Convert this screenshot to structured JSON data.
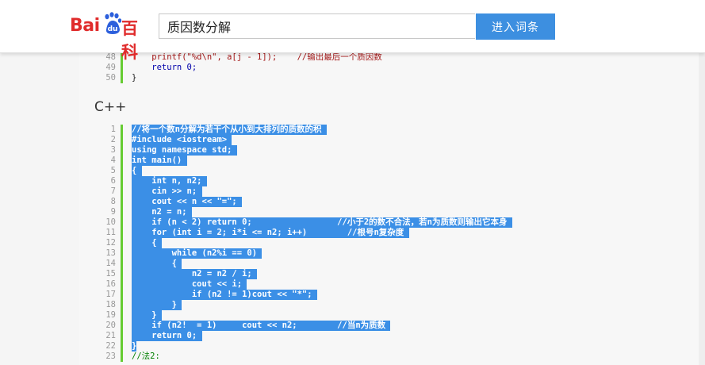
{
  "header": {
    "logo_text_left": "Bai",
    "logo_text_du": "du",
    "logo_text_baike": "百科",
    "search_value": "质因数分解",
    "search_button": "进入词条"
  },
  "top_code": [
    {
      "ln": "48",
      "text": "    printf(\"%d\\n\", a[j - 1]);    //输出最后一个质因数"
    },
    {
      "ln": "49",
      "text": "    return 0;"
    },
    {
      "ln": "50",
      "text": "}"
    }
  ],
  "section_heading": "C++",
  "cpp_code": [
    {
      "ln": "1",
      "text": "//将一个数n分解为若干个从小到大排列的质数的积 "
    },
    {
      "ln": "2",
      "text": "#include <iostream> "
    },
    {
      "ln": "3",
      "text": "using namespace std; "
    },
    {
      "ln": "4",
      "text": "int main() "
    },
    {
      "ln": "5",
      "text": "{ "
    },
    {
      "ln": "6",
      "text": "    int n, n2; "
    },
    {
      "ln": "7",
      "text": "    cin >> n; "
    },
    {
      "ln": "8",
      "text": "    cout << n << \"=\"; "
    },
    {
      "ln": "9",
      "text": "    n2 = n; "
    },
    {
      "ln": "10",
      "text": "    if (n < 2) return 0;                 //小于2的数不合法，若n为质数则输出它本身 "
    },
    {
      "ln": "11",
      "text": "    for (int i = 2; i*i <= n2; i++)        //根号n复杂度 "
    },
    {
      "ln": "12",
      "text": "    { "
    },
    {
      "ln": "13",
      "text": "        while (n2%i == 0) "
    },
    {
      "ln": "14",
      "text": "        { "
    },
    {
      "ln": "15",
      "text": "            n2 = n2 / i; "
    },
    {
      "ln": "16",
      "text": "            cout << i; "
    },
    {
      "ln": "17",
      "text": "            if (n2 != 1)cout << \"*\"; "
    },
    {
      "ln": "18",
      "text": "        } "
    },
    {
      "ln": "19",
      "text": "    } "
    },
    {
      "ln": "20",
      "text": "    if (n2!  = 1)     cout << n2;        //当n为质数 "
    },
    {
      "ln": "21",
      "text": "    return 0; "
    },
    {
      "ln": "22",
      "text": "}"
    },
    {
      "ln": "23",
      "text": "//法2:"
    }
  ],
  "colors": {
    "selection": "#3b8fe6",
    "gutter_bar": "#66cc33",
    "search_button_bg": "#3d8fe0",
    "logo_red": "#e02b2b"
  }
}
